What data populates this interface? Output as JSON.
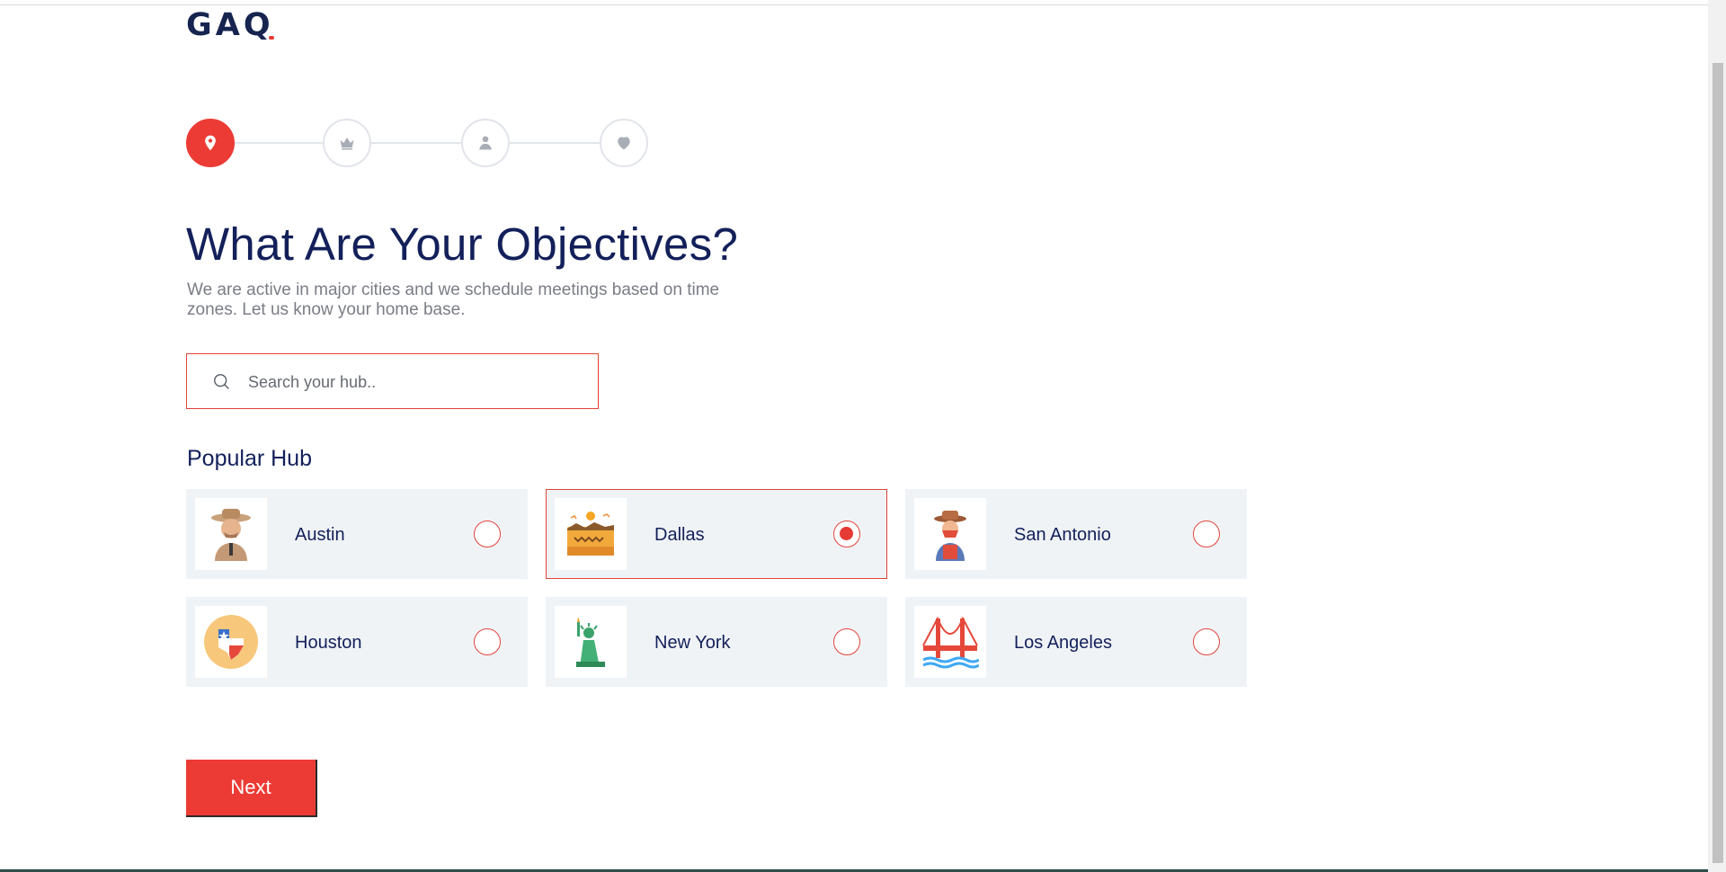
{
  "brand": {
    "logo_text": "GAQ",
    "accent_color": "#ec3b35",
    "text_color": "#13205a"
  },
  "stepper": {
    "steps": [
      {
        "icon": "location-pin-icon",
        "state": "active"
      },
      {
        "icon": "crown-icon",
        "state": "inactive"
      },
      {
        "icon": "user-icon",
        "state": "inactive"
      },
      {
        "icon": "heart-icon",
        "state": "inactive"
      }
    ]
  },
  "main": {
    "title": "What Are Your Objectives?",
    "subtitle": "We are active in major cities and we schedule meetings based on time zones. Let us know your home base."
  },
  "search": {
    "placeholder": "Search your hub..",
    "value": ""
  },
  "popular": {
    "heading": "Popular Hub",
    "hubs": [
      {
        "name": "Austin",
        "icon": "cowboy-icon",
        "selected": false
      },
      {
        "name": "Dallas",
        "icon": "desert-landscape-icon",
        "selected": true
      },
      {
        "name": "San Antonio",
        "icon": "bandit-icon",
        "selected": false
      },
      {
        "name": "Houston",
        "icon": "texas-map-icon",
        "selected": false
      },
      {
        "name": "New York",
        "icon": "statue-of-liberty-icon",
        "selected": false
      },
      {
        "name": "Los Angeles",
        "icon": "golden-gate-bridge-icon",
        "selected": false
      }
    ]
  },
  "actions": {
    "next_label": "Next"
  }
}
